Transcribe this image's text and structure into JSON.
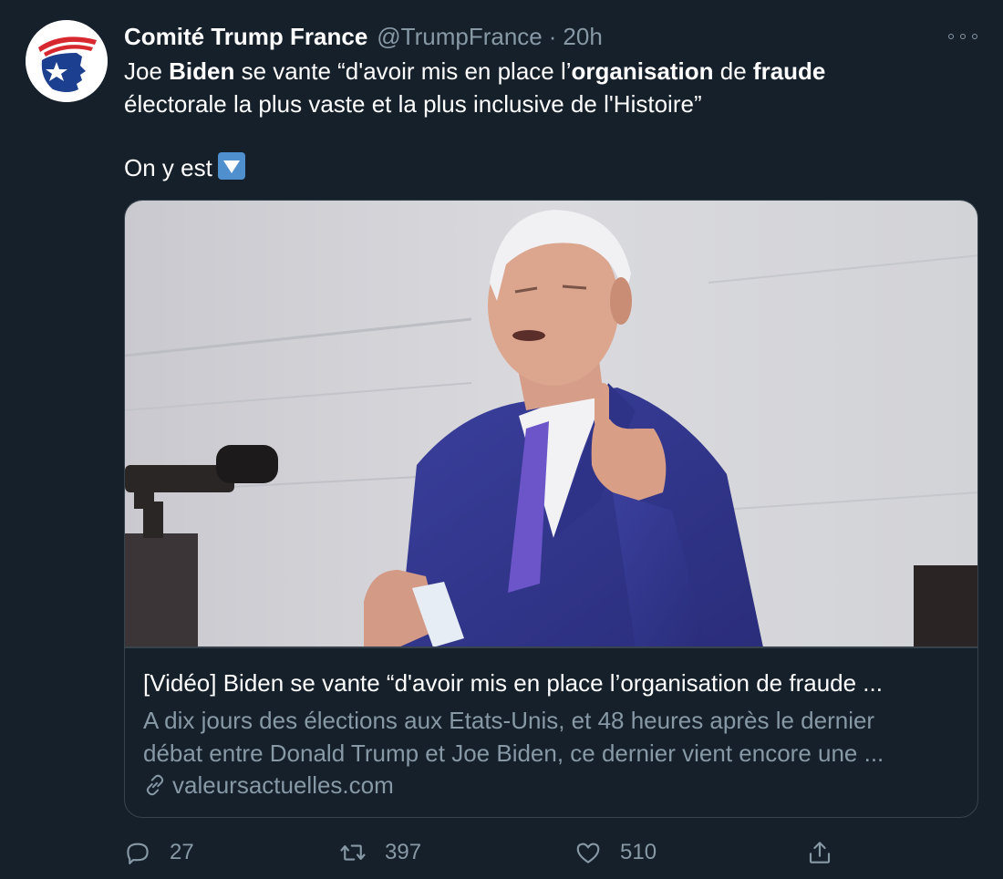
{
  "author": {
    "display_name": "Comité Trump France",
    "handle": "@TrumpFrance",
    "separator": "·",
    "time": "20h"
  },
  "tweet": {
    "line1": {
      "a": "Joe ",
      "b_bold": "Biden",
      "c": " se vante “d'avoir mis en place l’",
      "d_bold": "organisation",
      "e": " de ",
      "f_bold": "fraude"
    },
    "line2": "électorale la plus vaste et la plus inclusive de l'Histoire”",
    "line3": "On y est",
    "emoji": "down-arrow-button-emoji"
  },
  "card": {
    "title": "[Vidéo] Biden se vante “d'avoir mis en place l’organisation de fraude ...",
    "description_line1": "A dix jours des élections aux Etats-Unis, et 48 heures après le dernier",
    "description_line2": "débat entre Donald Trump et Joe Biden, ce dernier vient encore une ...",
    "domain": "valeursactuelles.com",
    "image_icon": "news-photo-speaker-at-podium"
  },
  "actions": {
    "reply_count": "27",
    "retweet_count": "397",
    "like_count": "510"
  },
  "colors": {
    "background": "#15202b",
    "secondary_text": "#8899a6",
    "border": "#38444d"
  }
}
